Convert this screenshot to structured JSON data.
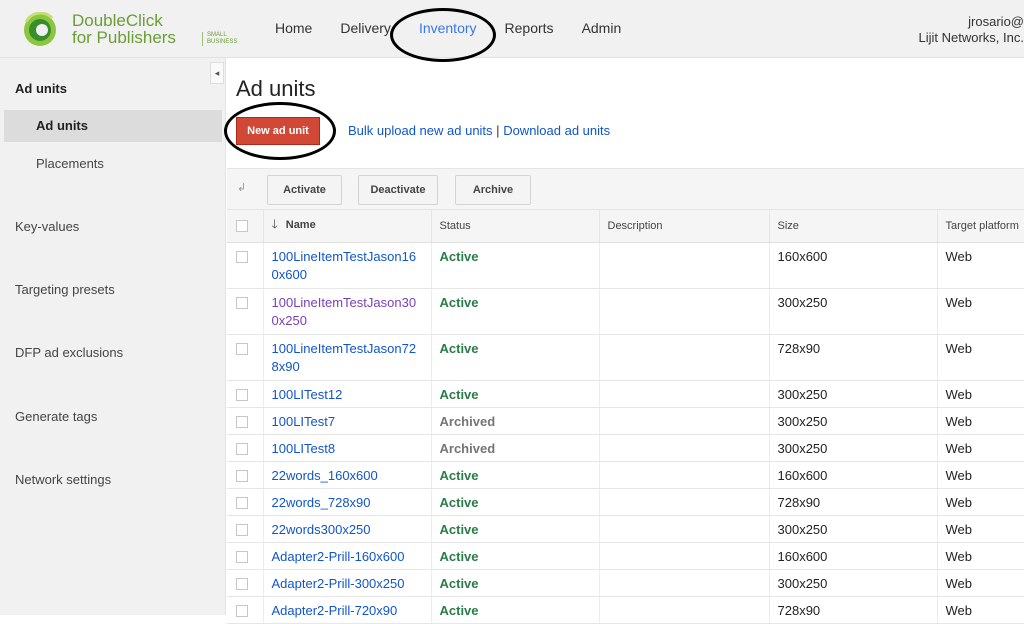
{
  "header": {
    "logo_line1": "DoubleClick",
    "logo_line2": "for Publishers",
    "logo_sub": "SMALL BUSINESS",
    "nav": [
      "Home",
      "Delivery",
      "Inventory",
      "Reports",
      "Admin"
    ],
    "active_nav": "Inventory",
    "user_name": "jrosario@",
    "user_org": "Lijit Networks, Inc."
  },
  "sidebar": {
    "collapse_glyph": "◂",
    "section_ad_units": "Ad units",
    "sub_ad_units": "Ad units",
    "sub_placements": "Placements",
    "key_values": "Key-values",
    "targeting_presets": "Targeting presets",
    "dfp_ad_exclusions": "DFP ad exclusions",
    "generate_tags": "Generate tags",
    "network_settings": "Network settings"
  },
  "main": {
    "title": "Ad units",
    "new_button": "New ad unit",
    "bulk_upload": "Bulk upload new ad units",
    "separator": "|",
    "download": "Download ad units",
    "toolbar": {
      "activate": "Activate",
      "deactivate": "Deactivate",
      "archive": "Archive"
    },
    "columns": [
      "Name",
      "Status",
      "Description",
      "Size",
      "Target platform"
    ],
    "rows": [
      {
        "name": "100LineItemTestJason160x600",
        "visited": false,
        "status": "Active",
        "description": "",
        "size": "160x600",
        "platform": "Web"
      },
      {
        "name": "100LineItemTestJason300x250",
        "visited": true,
        "status": "Active",
        "description": "",
        "size": "300x250",
        "platform": "Web"
      },
      {
        "name": "100LineItemTestJason728x90",
        "visited": false,
        "status": "Active",
        "description": "",
        "size": "728x90",
        "platform": "Web"
      },
      {
        "name": "100LITest12",
        "visited": false,
        "status": "Active",
        "description": "",
        "size": "300x250",
        "platform": "Web"
      },
      {
        "name": "100LITest7",
        "visited": false,
        "status": "Archived",
        "description": "",
        "size": "300x250",
        "platform": "Web"
      },
      {
        "name": "100LITest8",
        "visited": false,
        "status": "Archived",
        "description": "",
        "size": "300x250",
        "platform": "Web"
      },
      {
        "name": "22words_160x600",
        "visited": false,
        "status": "Active",
        "description": "",
        "size": "160x600",
        "platform": "Web"
      },
      {
        "name": "22words_728x90",
        "visited": false,
        "status": "Active",
        "description": "",
        "size": "728x90",
        "platform": "Web"
      },
      {
        "name": "22words300x250",
        "visited": false,
        "status": "Active",
        "description": "",
        "size": "300x250",
        "platform": "Web"
      },
      {
        "name": "Adapter2-Prill-160x600",
        "visited": false,
        "status": "Active",
        "description": "",
        "size": "160x600",
        "platform": "Web"
      },
      {
        "name": "Adapter2-Prill-300x250",
        "visited": false,
        "status": "Active",
        "description": "",
        "size": "300x250",
        "platform": "Web"
      },
      {
        "name": "Adapter2-Prill-720x90",
        "visited": false,
        "status": "Active",
        "description": "",
        "size": "728x90",
        "platform": "Web"
      }
    ]
  },
  "colors": {
    "active_status": "#2a7d48",
    "archived_status": "#757575",
    "link": "#1155cc",
    "visited_link": "#7b3fb8",
    "new_button": "#d14836",
    "brand_green": "#6a9e37"
  }
}
